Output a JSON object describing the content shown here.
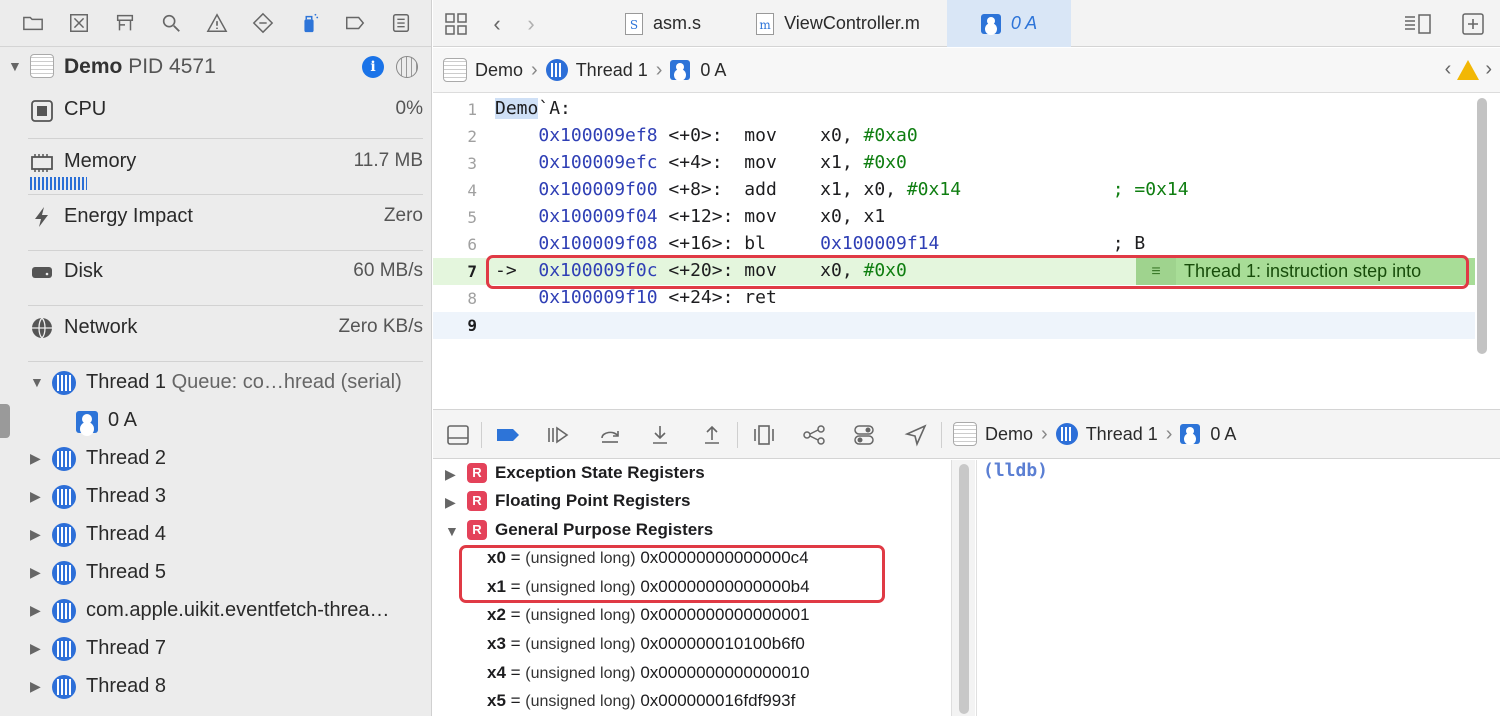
{
  "process": {
    "name": "Demo",
    "pid_label": "PID 4571"
  },
  "gauges": [
    {
      "label": "CPU",
      "value": "0%",
      "icon": "cpu-icon"
    },
    {
      "label": "Memory",
      "value": "11.7 MB",
      "icon": "memory-chip-icon"
    },
    {
      "label": "Energy Impact",
      "value": "Zero",
      "icon": "bolt-icon"
    },
    {
      "label": "Disk",
      "value": "60 MB/s",
      "icon": "disk-icon"
    },
    {
      "label": "Network",
      "value": "Zero KB/s",
      "icon": "globe-icon"
    }
  ],
  "threads": {
    "thread1": {
      "label": "Thread 1",
      "queue": "Queue: co…hread (serial)"
    },
    "frame": "0 A",
    "others": [
      "Thread 2",
      "Thread 3",
      "Thread 4",
      "Thread 5",
      "com.apple.uikit.eventfetch-threa…",
      "Thread 7",
      "Thread 8"
    ]
  },
  "tabs": [
    {
      "label": "asm.s",
      "icon_letter": "S"
    },
    {
      "label": "ViewController.m",
      "icon_letter": "m"
    },
    {
      "label": "0 A",
      "active": true
    }
  ],
  "jumpbar": {
    "app": "Demo",
    "thread": "Thread 1",
    "frame": "0 A"
  },
  "code": {
    "lines": [
      {
        "n": "1",
        "fn": "Demo",
        "rest": "`A:"
      },
      {
        "n": "2",
        "addr": "0x100009ef8",
        "off": " <+0>:  ",
        "op": "mov    x0, ",
        "imm": "#0xa0",
        "cmt": ""
      },
      {
        "n": "3",
        "addr": "0x100009efc",
        "off": " <+4>:  ",
        "op": "mov    x1, ",
        "imm": "#0x0",
        "cmt": ""
      },
      {
        "n": "4",
        "addr": "0x100009f00",
        "off": " <+8>:  ",
        "op": "add    x1, x0, ",
        "imm": "#0x14",
        "cmt": "              ; =0x14"
      },
      {
        "n": "5",
        "addr": "0x100009f04",
        "off": " <+12>: ",
        "op": "mov    x0, x1",
        "imm": "",
        "cmt": ""
      },
      {
        "n": "6",
        "addr": "0x100009f08",
        "off": " <+16>: ",
        "op": "bl     ",
        "imm": "",
        "addr2": "0x100009f14",
        "cmt2": "                ; B"
      },
      {
        "n": "7",
        "arrow": "->  ",
        "addr": "0x100009f0c",
        "off": " <+20>: ",
        "op": "mov    x0, ",
        "imm": "#0x0",
        "cmt": ""
      },
      {
        "n": "8",
        "addr": "0x100009f10",
        "off": " <+24>: ",
        "op": "ret",
        "imm": "",
        "cmt": ""
      },
      {
        "n": "9"
      }
    ],
    "annotation": "Thread 1: instruction step into"
  },
  "debug_path": {
    "app": "Demo",
    "thread": "Thread 1",
    "frame": "0 A"
  },
  "variables": {
    "groups": [
      "Exception State Registers",
      "Floating Point Registers",
      "General Purpose Registers"
    ],
    "registers": [
      {
        "name": "x0",
        "type": "(unsigned long)",
        "value": "0x00000000000000c4"
      },
      {
        "name": "x1",
        "type": "(unsigned long)",
        "value": "0x00000000000000b4"
      },
      {
        "name": "x2",
        "type": "(unsigned long)",
        "value": "0x0000000000000001"
      },
      {
        "name": "x3",
        "type": "(unsigned long)",
        "value": "0x000000010100b6f0"
      },
      {
        "name": "x4",
        "type": "(unsigned long)",
        "value": "0x0000000000000010"
      },
      {
        "name": "x5",
        "type": "(unsigned long)",
        "value": "0x000000016fdf993f"
      }
    ]
  },
  "console": {
    "prompt": "(lldb)"
  },
  "colors": {
    "accent": "#2d74d8",
    "highlight_line": "#e4f6dd",
    "annotation": "#a8dd97",
    "callout": "#e03a45",
    "register_badge": "#e4425a"
  }
}
